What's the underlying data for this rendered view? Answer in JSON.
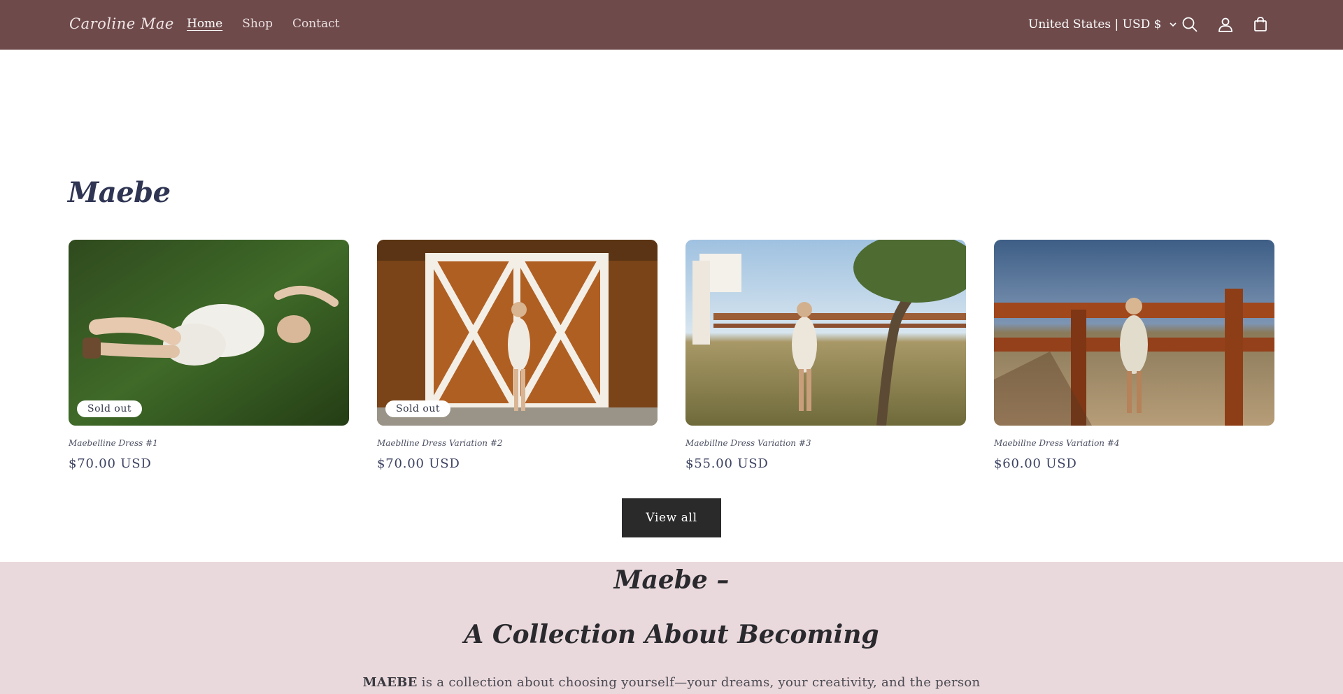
{
  "header": {
    "logo": "Caroline Mae",
    "nav": [
      {
        "label": "Home",
        "active": true
      },
      {
        "label": "Shop",
        "active": false
      },
      {
        "label": "Contact",
        "active": false
      }
    ],
    "locale": "United States | USD $",
    "icons": [
      "search-icon",
      "account-icon",
      "cart-icon"
    ],
    "background_color": "#6e4a4b"
  },
  "collection": {
    "title": "Maebe",
    "products": [
      {
        "name": "Maebelline Dress #1",
        "price": "$70.00 USD",
        "badge": "Sold out"
      },
      {
        "name": "Maeblline Dress Variation #2",
        "price": "$70.00 USD",
        "badge": "Sold out"
      },
      {
        "name": "Maebillne Dress Variation #3",
        "price": "$55.00 USD",
        "badge": ""
      },
      {
        "name": "Maebillne Dress Variation #4",
        "price": "$60.00 USD",
        "badge": ""
      }
    ],
    "view_all_label": "View all"
  },
  "band": {
    "title": "Maebe –",
    "subtitle": "A Collection About Becoming",
    "text_bold": "MAEBE",
    "text_rest": " is a collection about choosing yourself—your dreams, your creativity, and the person",
    "background_color": "#ead9dc"
  }
}
